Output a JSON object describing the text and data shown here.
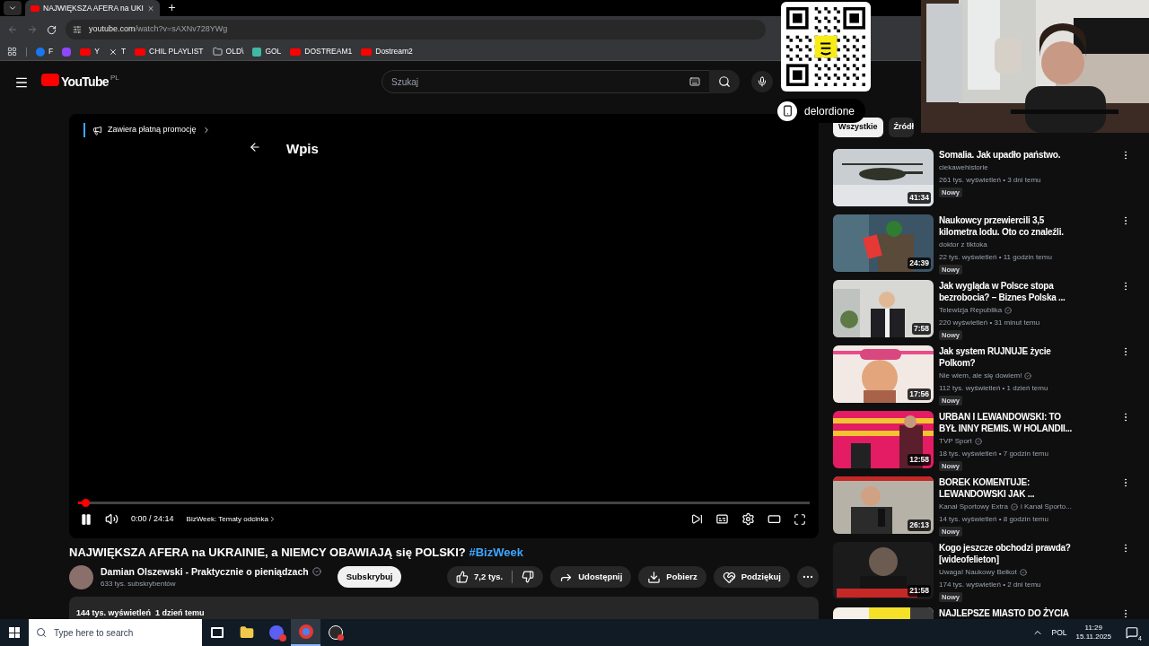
{
  "browser": {
    "tabs": [
      {
        "title": "NAJWIĘKSZA AFERA na UKI",
        "selected": true
      }
    ],
    "url_host": "youtube.com",
    "url_path": "/watch?v=sAXNv728YWg",
    "bookmarks": [
      {
        "kind": "facebook",
        "label": "F"
      },
      {
        "kind": "twitch"
      },
      {
        "kind": "youtube",
        "label": "Y"
      },
      {
        "kind": "x",
        "label": "T"
      },
      {
        "kind": "youtube",
        "label": "CHIL PLAYLIST"
      },
      {
        "kind": "folder",
        "label": "OLD\\"
      },
      {
        "kind": "gol",
        "label": "GOL"
      },
      {
        "kind": "youtube",
        "label": "DOSTREAM1"
      },
      {
        "kind": "youtube",
        "label": "Dostream2"
      }
    ]
  },
  "header": {
    "logo_text": "YouTube",
    "region": "PL",
    "search_placeholder": "Szukaj"
  },
  "player": {
    "promo": "Zawiera płatną promocję",
    "panel_title": "Wpis",
    "playing": true,
    "level": 0.01,
    "time": "0:00 / 24:14",
    "chapter": "BizWeek: Tematy odcinka"
  },
  "video": {
    "title": "NAJWIĘKSZA AFERA na UKRAINIE, a NIEMCY OBAWIAJĄ się POLSKI?",
    "hashtag": "#BizWeek",
    "channel": "Damian Olszewski - Praktycznie o pieniądzach",
    "verified": true,
    "subscribers": "633 tys. subskrybentów",
    "subscribe": "Subskrybuj",
    "likes": "7,2 tys.",
    "actions": [
      {
        "kind": "share",
        "label": "Udostępnij"
      },
      {
        "kind": "download",
        "label": "Pobierz"
      },
      {
        "kind": "thanks",
        "label": "Podziękuj"
      }
    ],
    "views": "144 tys. wyświetleń",
    "date": "1 dzień temu"
  },
  "chips": [
    {
      "label": "Wszystkie",
      "selected": true
    },
    {
      "label": "Źródł",
      "selected": false
    }
  ],
  "recommendations": [
    {
      "title_lines": [
        "Somalia. Jak upadło państwo."
      ],
      "channel": "ciekawehistorie",
      "verified": false,
      "meta": "261 tys. wyświetleń • 3 dni temu",
      "badge": "Nowy",
      "duration": "41:34"
    },
    {
      "title_lines": [
        "Naukowcy przewiercili 3,5",
        "kilometra lodu. Oto co znaleźli."
      ],
      "channel": "doktor z tiktoka",
      "verified": false,
      "meta": "22 tys. wyświetleń • 11 godzin temu",
      "badge": "Nowy",
      "duration": "24:39"
    },
    {
      "title_lines": [
        "Jak wygląda w Polsce stopa",
        "bezrobocia? – Biznes Polska ..."
      ],
      "channel": "Telewizja Republika",
      "verified": true,
      "meta": "220 wyświetleń • 31 minut temu",
      "badge": "Nowy",
      "duration": "7:58"
    },
    {
      "title_lines": [
        "Jak system RUJNUJE życie",
        "Polkom?"
      ],
      "channel": "Nie wiem, ale się dowiem!",
      "verified": true,
      "meta": "112 tys. wyświetleń • 1 dzień temu",
      "badge": "Nowy",
      "duration": "17:56"
    },
    {
      "title_lines": [
        "URBAN I LEWANDOWSKI: TO",
        "BYŁ INNY REMIS. W HOLANDII..."
      ],
      "channel": "TVP Sport",
      "verified": true,
      "meta": "18 tys. wyświetleń • 7 godzin temu",
      "badge": "Nowy",
      "duration": "12:58"
    },
    {
      "title_lines": [
        "BOREK KOMENTUJE:",
        "LEWANDOWSKI JAK ..."
      ],
      "channel": "Kanał Sportowy Extra",
      "verified": true,
      "channel_extra": "i Kanał Sporto...",
      "meta": "14 tys. wyświetleń • 8 godzin temu",
      "badge": "Nowy",
      "duration": "26:13"
    },
    {
      "title_lines": [
        "Kogo jeszcze obchodzi prawda?",
        "[wideofelieton]"
      ],
      "channel": "Uwaga! Naukowy Bełkot",
      "verified": true,
      "meta": "174 tys. wyświetleń • 2 dni temu",
      "badge": "Nowy",
      "duration": "21:58"
    },
    {
      "title_lines": [
        "NAJLEPSZE MIASTO DO ŻYCIA"
      ]
    }
  ],
  "stream_overlay": {
    "handle": "delordione"
  },
  "taskbar": {
    "search_placeholder": "Type here to search",
    "apps": [
      {
        "kind": "taskview",
        "selected": false
      },
      {
        "kind": "explorer",
        "selected": false
      },
      {
        "kind": "messenger",
        "selected": false
      },
      {
        "kind": "chrome",
        "selected": true
      },
      {
        "kind": "obs",
        "selected": false
      }
    ],
    "language": "POL",
    "time": "11:29",
    "date": "15.11.2025",
    "notifications": "4"
  }
}
